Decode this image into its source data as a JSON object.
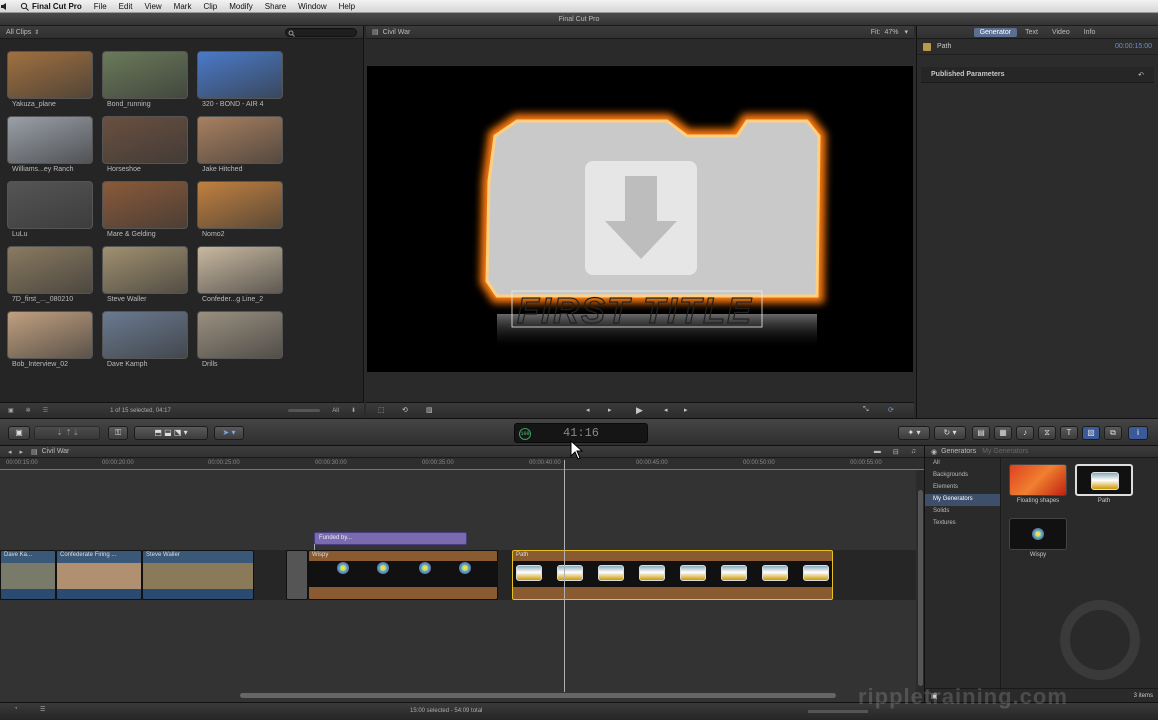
{
  "menubar": {
    "apple": "",
    "app": "Final Cut Pro",
    "items": [
      "File",
      "Edit",
      "View",
      "Mark",
      "Clip",
      "Modify",
      "Share",
      "Window",
      "Help"
    ]
  },
  "window_title": "Final Cut Pro",
  "browser": {
    "filter": "All Clips",
    "clips": [
      {
        "label": "Yakuza_plane",
        "color": "#a07040"
      },
      {
        "label": "Bond_running",
        "color": "#6a7a5a"
      },
      {
        "label": "320 - BOND - AIR 4",
        "color": "#4a7ac8"
      },
      {
        "label": "Williams...ey Ranch",
        "color": "#9aa0a8"
      },
      {
        "label": "Horseshoe",
        "color": "#6a5040"
      },
      {
        "label": "Jake Hitched",
        "color": "#a88060"
      },
      {
        "label": "LuLu",
        "color": "#555555"
      },
      {
        "label": "Mare & Gelding",
        "color": "#8a5a3a"
      },
      {
        "label": "Nomo2",
        "color": "#c08040"
      },
      {
        "label": "7D_first_..._080210",
        "color": "#8a7a60"
      },
      {
        "label": "Steve Waller",
        "color": "#a09070"
      },
      {
        "label": "Confeder...g Line_2",
        "color": "#c8b8a0"
      },
      {
        "label": "Bob_Interview_02",
        "color": "#c0a080"
      },
      {
        "label": "Dave Kamph",
        "color": "#6a7a90"
      },
      {
        "label": "Drills",
        "color": "#9a9080"
      }
    ],
    "footer": {
      "selection": "1 of 15 selected, 04:17",
      "all": "All"
    }
  },
  "viewer": {
    "title": "Civil War",
    "fit_label": "Fit:",
    "zoom": "47%",
    "title_text": "FIRST TITLE"
  },
  "inspector": {
    "tabs": [
      "Generator",
      "Text",
      "Video",
      "Info"
    ],
    "active_tab": "Generator",
    "clip_name": "Path",
    "duration": "00:00:15:00",
    "section": "Published Parameters"
  },
  "toolbar": {
    "timecode": "41:16",
    "badge": "100"
  },
  "timeline": {
    "project": "Civil War",
    "ruler": [
      "00:00:15:00",
      "00:00:20:00",
      "00:00:25:00",
      "00:00:30:00",
      "00:00:35:00",
      "00:00:40:00",
      "00:00:45:00",
      "00:00:50:00",
      "00:00:55:00"
    ],
    "title_clip": "Funded by...",
    "clips": [
      {
        "name": "Dave Ka..."
      },
      {
        "name": "Confederate Firing ..."
      },
      {
        "name": "Steve Waller"
      },
      {
        "name": "Wispy"
      },
      {
        "name": "Path"
      }
    ]
  },
  "generators": {
    "title": "Generators",
    "crumb": "My Generators",
    "categories": [
      "All",
      "Backgrounds",
      "Elements",
      "My Generators",
      "Solids",
      "Textures"
    ],
    "selected": "My Generators",
    "items": [
      {
        "label": "Floating shapes"
      },
      {
        "label": "Path"
      },
      {
        "label": "Wispy"
      }
    ],
    "count": "3 items"
  },
  "status": {
    "text": "15:00 selected - 54:09 total"
  },
  "watermark": "rippletraining.com"
}
